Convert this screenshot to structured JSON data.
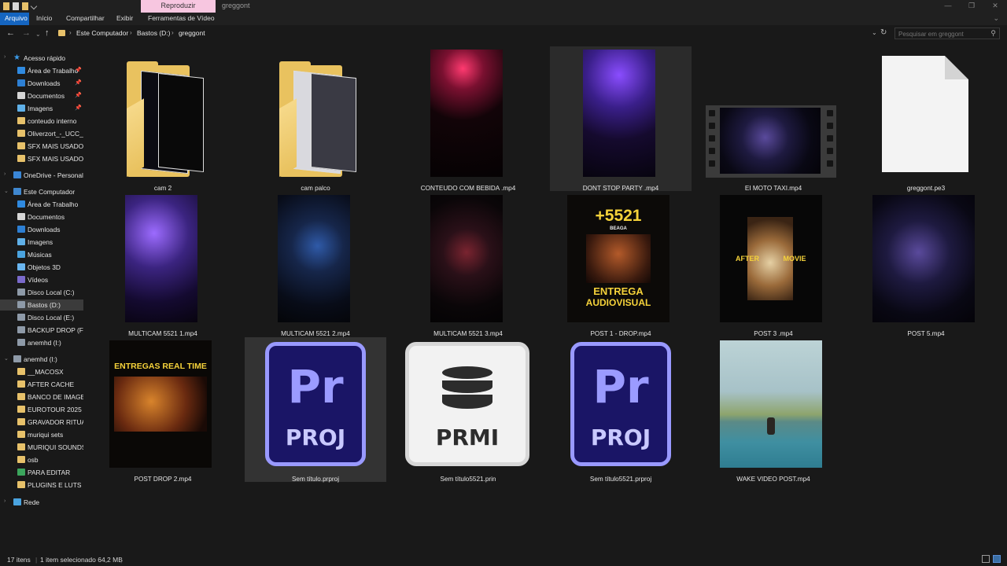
{
  "titlebar": {
    "contextual_tab": "Reproduzir",
    "window_title": "greggont",
    "controls": [
      "minimize-icon",
      "maximize-icon",
      "close-icon"
    ]
  },
  "ribbon": {
    "tabs": [
      "Arquivo",
      "Início",
      "Compartilhar",
      "Exibir",
      "Ferramentas de Vídeo"
    ],
    "active_tab": "Arquivo"
  },
  "address": {
    "crumbs": [
      "Este Computador",
      "Bastos (D:)",
      "greggont"
    ],
    "search_placeholder": "Pesquisar em greggont"
  },
  "sidebar": {
    "quick_access": {
      "label": "Acesso rápido",
      "items": [
        {
          "label": "Área de Trabalho",
          "icon": "desktop-icon",
          "pinned": true
        },
        {
          "label": "Downloads",
          "icon": "download-icon",
          "pinned": true
        },
        {
          "label": "Documentos",
          "icon": "documents-icon",
          "pinned": true
        },
        {
          "label": "Imagens",
          "icon": "pictures-icon",
          "pinned": true
        },
        {
          "label": "conteudo interno",
          "icon": "folder-icon"
        },
        {
          "label": "Oliverzort_-_UCC_L",
          "icon": "folder-icon"
        },
        {
          "label": "SFX MAIS USADOS",
          "icon": "folder-icon"
        },
        {
          "label": "SFX MAIS USADOS",
          "icon": "folder-icon"
        }
      ]
    },
    "onedrive": "OneDrive - Personal",
    "this_pc": {
      "label": "Este Computador",
      "items": [
        {
          "label": "Área de Trabalho",
          "icon": "desktop-icon"
        },
        {
          "label": "Documentos",
          "icon": "documents-icon"
        },
        {
          "label": "Downloads",
          "icon": "download-icon"
        },
        {
          "label": "Imagens",
          "icon": "pictures-icon"
        },
        {
          "label": "Músicas",
          "icon": "music-icon"
        },
        {
          "label": "Objetos 3D",
          "icon": "3d-objects-icon"
        },
        {
          "label": "Vídeos",
          "icon": "videos-icon"
        },
        {
          "label": "Disco Local (C:)",
          "icon": "drive-icon"
        },
        {
          "label": "Bastos (D:)",
          "icon": "drive-icon",
          "selected": true
        },
        {
          "label": "Disco Local (E:)",
          "icon": "drive-icon"
        },
        {
          "label": "BACKUP DROP (F:)",
          "icon": "drive-icon"
        },
        {
          "label": "anemhd (I:)",
          "icon": "drive-icon"
        }
      ]
    },
    "anemhd": {
      "label": "anemhd (I:)",
      "items": [
        {
          "label": "__MACOSX",
          "icon": "folder-icon"
        },
        {
          "label": "AFTER CACHE",
          "icon": "folder-icon"
        },
        {
          "label": "BANCO DE IMAGE",
          "icon": "folder-icon"
        },
        {
          "label": "EUROTOUR 2025",
          "icon": "folder-icon"
        },
        {
          "label": "GRAVADOR RITUAL",
          "icon": "folder-icon"
        },
        {
          "label": "muriqui sets",
          "icon": "folder-icon"
        },
        {
          "label": "MURIQUI SOUNDS",
          "icon": "folder-icon"
        },
        {
          "label": "osb",
          "icon": "folder-icon"
        },
        {
          "label": "PARA EDITAR",
          "icon": "green-folder-icon"
        },
        {
          "label": "PLUGINS E LUTS",
          "icon": "folder-icon"
        }
      ]
    },
    "network": "Rede"
  },
  "files": [
    {
      "name": "cam 2",
      "kind": "folder",
      "icon": "folder-icon"
    },
    {
      "name": "cam palco",
      "kind": "folder",
      "icon": "folder-icon"
    },
    {
      "name": "CONTEUDO COM BEBIDA .mp4",
      "kind": "video",
      "icon": "video-thumbnail"
    },
    {
      "name": "DONT STOP PARTY .mp4",
      "kind": "video",
      "icon": "video-thumbnail",
      "hovered": true
    },
    {
      "name": "EI MOTO TAXI.mp4",
      "kind": "video",
      "icon": "filmstrip-thumbnail"
    },
    {
      "name": "greggont.pe3",
      "kind": "file",
      "icon": "blank-file-icon"
    },
    {
      "name": "MULTICAM 5521  1.mp4",
      "kind": "video",
      "icon": "video-thumbnail"
    },
    {
      "name": "MULTICAM 5521 2.mp4",
      "kind": "video",
      "icon": "video-thumbnail"
    },
    {
      "name": "MULTICAM 5521 3.mp4",
      "kind": "video",
      "icon": "video-thumbnail"
    },
    {
      "name": "POST 1 - DROP.mp4",
      "kind": "video",
      "icon": "poster-thumbnail"
    },
    {
      "name": "POST 3 .mp4",
      "kind": "video",
      "icon": "poster-thumbnail"
    },
    {
      "name": "POST 5.mp4",
      "kind": "video",
      "icon": "video-thumbnail"
    },
    {
      "name": "POST DROP 2.mp4",
      "kind": "video",
      "icon": "poster-thumbnail"
    },
    {
      "name": "Sem título.prproj",
      "kind": "premiere-project",
      "icon": "premiere-project-icon",
      "selected": true
    },
    {
      "name": "Sem título5521.prin",
      "kind": "premiere-ingest",
      "icon": "prmi-database-icon"
    },
    {
      "name": "Sem título5521.prproj",
      "kind": "premiere-project",
      "icon": "premiere-project-icon"
    },
    {
      "name": "WAKE VIDEO POST.mp4",
      "kind": "video",
      "icon": "video-thumbnail"
    }
  ],
  "thumb_text": {
    "post1_big": "+5521",
    "post1_small": "BEAGA",
    "post1_bottom1": "ENTREGA",
    "post1_bottom2": "AUDIOVISUAL",
    "post3_left": "AFTER",
    "post3_right": "MOVIE",
    "postdrop_title": "ENTREGAS REAL TIME",
    "pr_big": "Pr",
    "pr_small": "PROJ",
    "prmi_small": "PRMI"
  },
  "status": {
    "count": "17 itens",
    "selection": "1 item selecionado  64,2 MB"
  },
  "colors": {
    "accent": "#1565c0",
    "contextual_tab": "#f7c6e0",
    "background": "#191919",
    "premiere_border": "#9999ff",
    "premiere_fill": "#1a1566",
    "folder": "#e9c25f",
    "poster_text": "#f5d23a"
  }
}
